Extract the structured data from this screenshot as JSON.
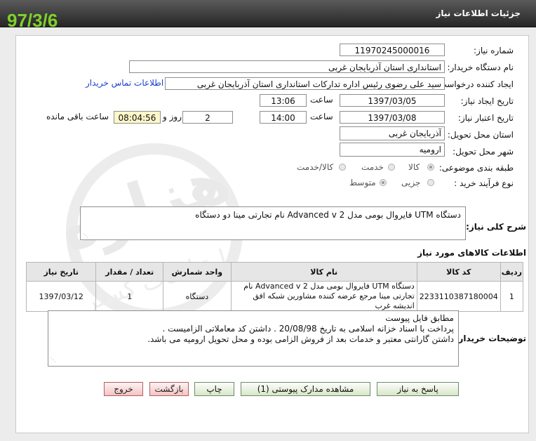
{
  "window": {
    "title": "جزئیات اطلاعات نیاز",
    "stamp": "97/3/6"
  },
  "fields": {
    "need_number": {
      "label": "شماره نیاز:",
      "value": "11970245000016"
    },
    "buyer_org": {
      "label": "نام دستگاه خریدار:",
      "value": "استانداری استان آذربایجان غربی"
    },
    "requester": {
      "label": "ایجاد کننده درخواست:",
      "value": "سید علی رضوی رئیس اداره تدارکات استانداری استان آذربایجان غربی"
    },
    "contact_link": "اطلاعات تماس خریدار",
    "created": {
      "label": "تاریخ ایجاد نیاز:",
      "date": "1397/03/05",
      "time_label": "ساعت",
      "time": "13:06"
    },
    "deadline": {
      "label": "تاریخ اعتبار نیاز:",
      "date": "1397/03/08",
      "time_label": "ساعت",
      "time": "14:00",
      "days": "2",
      "day_label": "روز و",
      "remaining": "08:04:56",
      "remaining_label": "ساعت باقی مانده"
    },
    "province": {
      "label": "استان محل تحویل:",
      "value": "آذربایجان غربی"
    },
    "city": {
      "label": "شهر محل تحویل:",
      "value": "ارومیه"
    },
    "category": {
      "label": "طبقه بندی موضوعی:",
      "options": [
        "کالا",
        "خدمت",
        "کالا/خدمت"
      ],
      "selected": "کالا"
    },
    "process": {
      "label": "نوع فرآیند خرید :",
      "options": [
        "جزیی",
        "متوسط"
      ],
      "selected": "متوسط"
    }
  },
  "summary": {
    "label": "شرح کلی نیاز:",
    "value": "دستگاه UTM فایروال بومی مدل Advanced v 2  نام تجارتی مینا    دو دستگاه"
  },
  "goods": {
    "section_title": "اطلاعات کالاهای مورد نیاز",
    "columns": [
      "ردیف",
      "کد کالا",
      "نام کالا",
      "واحد شمارش",
      "تعداد / مقدار",
      "تاریخ نیاز"
    ],
    "rows": [
      {
        "row": "1",
        "code": "2233110387180004",
        "name": "دستگاه UTM فایروال بومی مدل Advanced v 2 نام تجارتی مینا مرجع عرضه کننده مشاورین شبکه افق اندیشه غرب",
        "unit": "دستگاه",
        "qty": "1",
        "date": "1397/03/12"
      }
    ]
  },
  "notes": {
    "label": "توضیحات خریدار:",
    "lines": [
      "مطابق فایل پیوست",
      "پرداخت با اسناد خزانه اسلامی به تاریخ 20/08/98 . داشتن کد معاملاتی الزامیست .",
      "داشتن گارانتی معتبر و خدمات بعد از فروش الزامی بوده و محل تحویل ارومیه می باشد."
    ]
  },
  "buttons": {
    "reply": "پاسخ به نیاز",
    "attachments": "مشاهده مدارک پیوستی (1)",
    "print": "چاپ",
    "back": "بازگشت",
    "exit": "خروج"
  },
  "colors": {
    "titlebar": "#333333",
    "stamp": "#7ed12a",
    "link": "#1a3fd0",
    "yellow_field": "#fff7c9"
  }
}
